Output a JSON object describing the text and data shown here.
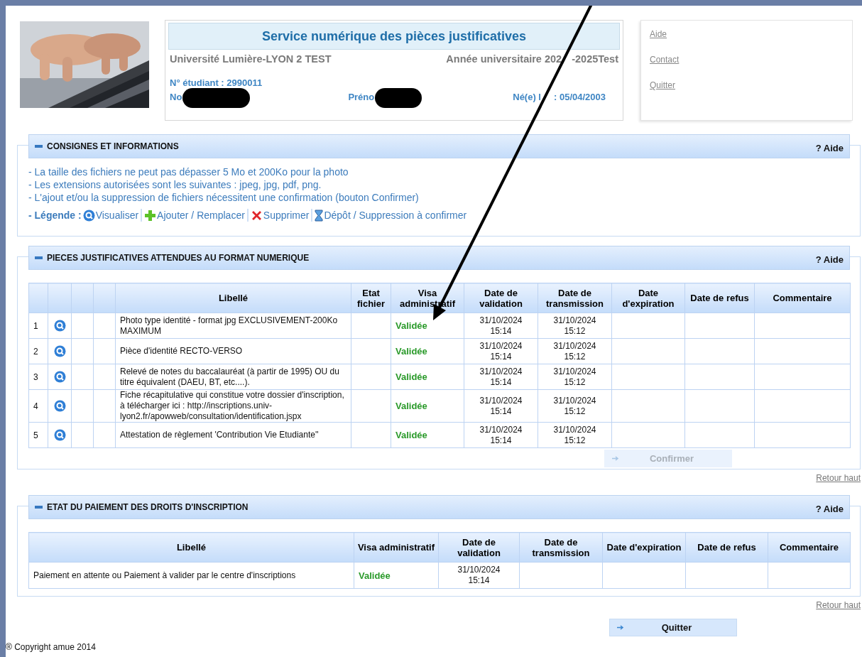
{
  "header": {
    "title": "Service numérique des pièces justificatives",
    "university": "Université Lumière-LYON 2 TEST",
    "academic_year": [
      "Année universitaire 202",
      "-2025Test"
    ],
    "student_number": "N° étudiant : 2990011",
    "name_label": "No",
    "first_name_label": "Préno",
    "birth_date": [
      "Né(e) l",
      ": 05/04/2003"
    ]
  },
  "header_links": [
    "Aide",
    "Contact",
    "Quitter"
  ],
  "instructions": {
    "title": "CONSIGNES ET INFORMATIONS",
    "help": "? Aide",
    "lines": [
      "- La taille des fichiers ne peut pas dépasser 5 Mo et 200Ko pour la photo",
      "- Les extensions autorisées sont les suivantes : jpeg, jpg, pdf, png.",
      "- L'ajout et/ou la suppression de fichiers nécessitent une confirmation (bouton Confirmer)"
    ],
    "legend": {
      "label": "- Légende :",
      "items": [
        {
          "kind": "view",
          "label": "Visualiser"
        },
        {
          "kind": "add",
          "label": "Ajouter / Remplacer"
        },
        {
          "kind": "delete",
          "label": "Supprimer"
        },
        {
          "kind": "pending",
          "label": "Dépôt / Suppression à confirmer"
        }
      ]
    }
  },
  "documents": {
    "title": "PIECES JUSTIFICATIVES ATTENDUES AU FORMAT NUMERIQUE",
    "help": "? Aide",
    "columns": [
      "Libellé",
      "Etat fichier",
      "Visa administratif",
      "Date de validation",
      "Date de transmission",
      "Date d'expiration",
      "Date de refus",
      "Commentaire"
    ],
    "rows": [
      {
        "number": "1",
        "label": "Photo type identité - format jpg EXCLUSIVEMENT-200Ko MAXIMUM",
        "visa": "Validée",
        "validated": "31/10/2024 15:14",
        "transmitted": "31/10/2024 15:12"
      },
      {
        "number": "2",
        "label": "Pièce d'identité RECTO-VERSO",
        "visa": "Validée",
        "validated": "31/10/2024 15:14",
        "transmitted": "31/10/2024 15:12"
      },
      {
        "number": "3",
        "label": "Relevé de notes du baccalauréat (à partir de 1995) OU du titre équivalent (DAEU, BT, etc....).",
        "visa": "Validée",
        "validated": "31/10/2024 15:14",
        "transmitted": "31/10/2024 15:12"
      },
      {
        "number": "4",
        "label": "Fiche récapitulative qui constitue votre dossier d'inscription, à télécharger ici : http://inscriptions.univ-lyon2.fr/apowweb/consultation/identification.jspx",
        "visa": "Validée",
        "validated": "31/10/2024 15:14",
        "transmitted": "31/10/2024 15:12"
      },
      {
        "number": "5",
        "label": "Attestation de règlement 'Contribution Vie Etudiante''",
        "visa": "Validée",
        "validated": "31/10/2024 15:14",
        "transmitted": "31/10/2024 15:12"
      }
    ],
    "confirm_button": {
      "label": "Confirmer",
      "disabled": true
    },
    "back_to_top": "Retour haut"
  },
  "payment": {
    "title": "ETAT DU PAIEMENT DES DROITS D'INSCRIPTION",
    "help": "? Aide",
    "columns": [
      "Libellé",
      "Visa administratif",
      "Date de validation",
      "Date de transmission",
      "Date d'expiration",
      "Date de refus",
      "Commentaire"
    ],
    "rows": [
      {
        "label": "Paiement en attente ou Paiement à valider par le centre d'inscriptions",
        "visa": "Validée",
        "validated": "31/10/2024 15:14"
      }
    ],
    "back_to_top": "Retour haut"
  },
  "quit_button": {
    "label": "Quitter",
    "disabled": false
  },
  "copyright": "® Copyright amue 2014"
}
